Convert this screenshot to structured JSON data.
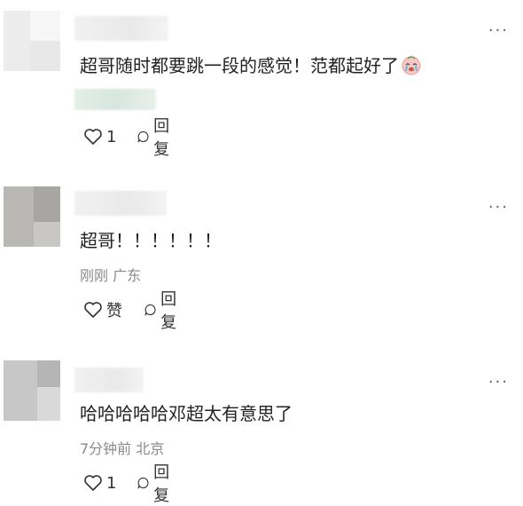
{
  "comments": [
    {
      "text": "超哥随时都要跳一段的感觉！范都起好了",
      "emoji": "crying-face-emoji",
      "meta": "",
      "like_label": "1",
      "reply_label": "回复"
    },
    {
      "text": "超哥！！！！！！",
      "meta": "刚刚 广东",
      "like_label": "赞",
      "reply_label": "回复"
    },
    {
      "text": "哈哈哈哈哈邓超太有意思了",
      "meta": "7分钟前 北京",
      "like_label": "1",
      "reply_label": "回复"
    }
  ],
  "more_label": "···",
  "icons": {
    "like": "heart-outline-icon",
    "reply": "comment-bubble-icon",
    "more": "more-dots-icon"
  },
  "colors": {
    "text": "#222222",
    "meta": "#8a8a8a",
    "avatar_placeholder": "#cfcfcf"
  }
}
